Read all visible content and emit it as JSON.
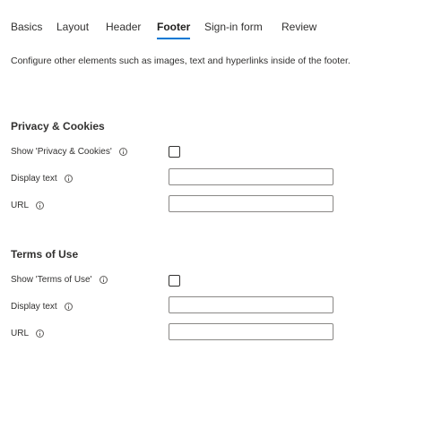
{
  "tabs": [
    {
      "label": "Basics",
      "active": false
    },
    {
      "label": "Layout",
      "active": false
    },
    {
      "label": "Header",
      "active": false
    },
    {
      "label": "Footer",
      "active": true
    },
    {
      "label": "Sign-in form",
      "active": false
    },
    {
      "label": "Review",
      "active": false
    }
  ],
  "description": "Configure other elements such as images, text and hyperlinks inside of the footer.",
  "accent_color": "#0078d4",
  "privacy": {
    "title": "Privacy & Cookies",
    "show_label": "Show 'Privacy & Cookies'",
    "show_checked": false,
    "display_text_label": "Display text",
    "display_text_value": "",
    "url_label": "URL",
    "url_value": ""
  },
  "terms": {
    "title": "Terms of Use",
    "show_label": "Show 'Terms of Use'",
    "show_checked": false,
    "display_text_label": "Display text",
    "display_text_value": "",
    "url_label": "URL",
    "url_value": ""
  },
  "icons": {
    "info": "info-icon"
  }
}
